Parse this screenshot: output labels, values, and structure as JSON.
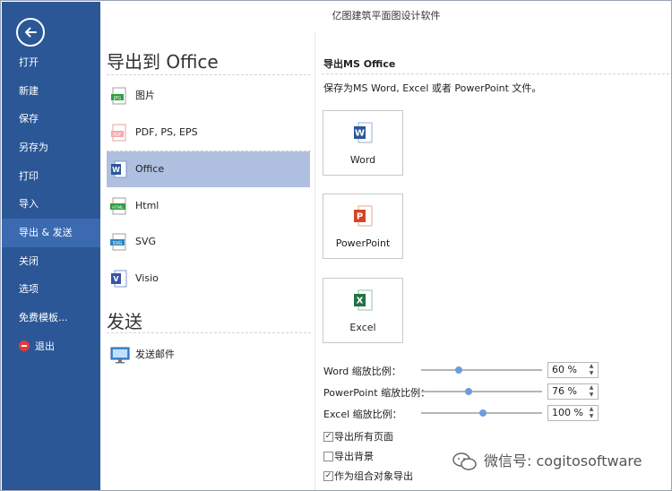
{
  "window": {
    "title": "亿图建筑平面图设计软件"
  },
  "sidebar": {
    "back_icon": "back-arrow-icon",
    "items": [
      {
        "label": "打开"
      },
      {
        "label": "新建"
      },
      {
        "label": "保存"
      },
      {
        "label": "另存为"
      },
      {
        "label": "打印"
      },
      {
        "label": "导入"
      },
      {
        "label": "导出 & 发送",
        "active": true
      },
      {
        "label": "关闭"
      },
      {
        "label": "选项"
      },
      {
        "label": "免费模板..."
      },
      {
        "label": "退出"
      }
    ]
  },
  "export": {
    "heading": "导出到 Office",
    "items": [
      {
        "label": "图片",
        "icon": "jpg-file-icon"
      },
      {
        "label": "PDF, PS, EPS",
        "icon": "pdf-file-icon"
      },
      {
        "label": "Office",
        "icon": "word-file-icon",
        "selected": true
      },
      {
        "label": "Html",
        "icon": "html-file-icon"
      },
      {
        "label": "SVG",
        "icon": "svg-file-icon"
      },
      {
        "label": "Visio",
        "icon": "visio-file-icon"
      }
    ],
    "send_heading": "发送",
    "send_items": [
      {
        "label": "发送邮件",
        "icon": "email-monitor-icon"
      }
    ]
  },
  "right_panel": {
    "title": "导出MS Office",
    "description": "保存为MS Word, Excel 或者 PowerPoint 文件。",
    "apps": [
      {
        "label": "Word",
        "icon": "word-icon",
        "color": "#2b579a"
      },
      {
        "label": "PowerPoint",
        "icon": "powerpoint-icon",
        "color": "#d24726"
      },
      {
        "label": "Excel",
        "icon": "excel-icon",
        "color": "#217346"
      }
    ],
    "zoom": [
      {
        "label": "Word 缩放比例：",
        "value": "60 %",
        "slider_fraction": 0.31
      },
      {
        "label": "PowerPoint 缩放比例：",
        "value": "76 %",
        "slider_fraction": 0.39
      },
      {
        "label": "Excel 缩放比例：",
        "value": "100 %",
        "slider_fraction": 0.51
      }
    ],
    "checkboxes": [
      {
        "label": "导出所有页面",
        "checked": true
      },
      {
        "label": "导出背景",
        "checked": false
      },
      {
        "label": "作为组合对象导出",
        "checked": true
      }
    ]
  },
  "watermark": {
    "text": "微信号: cogitosoftware",
    "icon": "wechat-icon"
  },
  "colors": {
    "sidebar": "#2b5797",
    "sidebar_active": "#3b6ab0",
    "selected_row": "#aebfe0",
    "slider_thumb": "#6f9bdd"
  }
}
